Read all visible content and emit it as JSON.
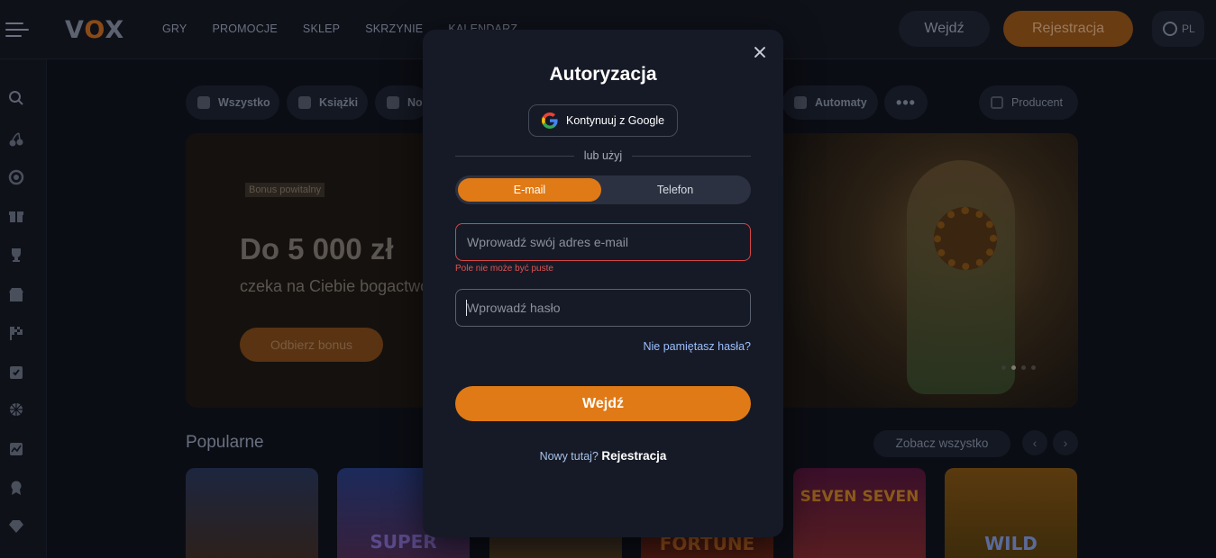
{
  "header": {
    "logo": "VOX",
    "nav": [
      "GRY",
      "PROMOCJE",
      "SKLEP",
      "SKRZYNIE",
      "KALENDARZ"
    ],
    "login_label": "Wejdź",
    "register_label": "Rejestracja",
    "lang": "PL"
  },
  "categories": [
    "Wszystko",
    "Książki",
    "No",
    "Automaty",
    "Producent"
  ],
  "hero": {
    "tag": "Bonus powitalny",
    "title": "Do 5 000 zł",
    "subtitle": "czeka na Ciebie bogactwo",
    "button": "Odbierz bonus"
  },
  "popular": {
    "title": "Popularne",
    "see_all": "Zobacz wszystko",
    "cards": [
      "",
      "SUPER",
      "",
      "FORTUNE",
      "SEVEN SEVEN",
      "WILD"
    ]
  },
  "modal": {
    "title": "Autoryzacja",
    "google_label": "Kontynuuj z Google",
    "divider": "lub użyj",
    "tabs": [
      "E-mail",
      "Telefon"
    ],
    "email_placeholder": "Wprowadź swój adres e-mail",
    "email_error": "Pole nie może być puste",
    "password_placeholder": "Wprowadź hasło",
    "forgot": "Nie pamiętasz hasła?",
    "submit": "Wejdź",
    "footer_prefix": "Nowy tutaj?",
    "footer_link": "Rejestracja"
  },
  "colors": {
    "accent": "#e07a16",
    "error": "#d64545",
    "modal_bg": "#161a26"
  }
}
